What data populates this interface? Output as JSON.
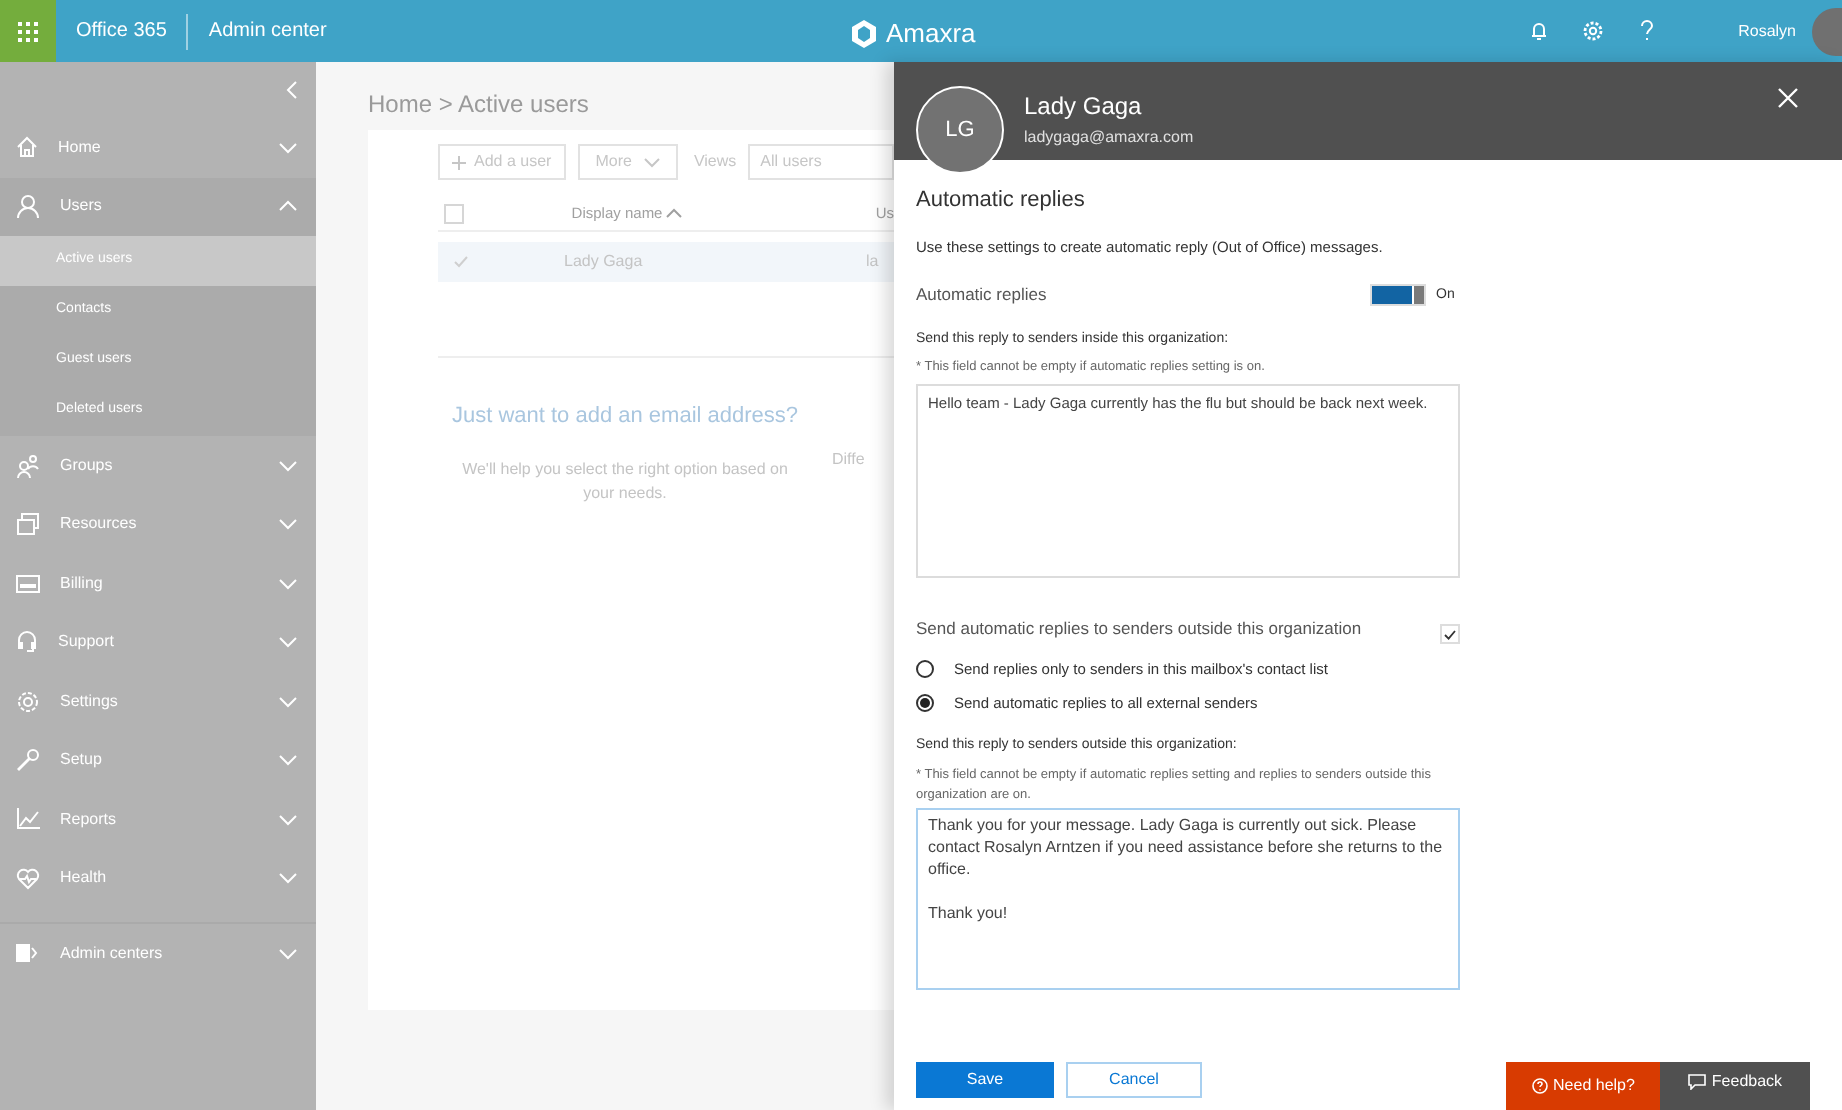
{
  "top_bar": {
    "product": "Office 365",
    "section": "Admin center",
    "brand": "Amaxra",
    "user": "Rosalyn"
  },
  "sidebar": {
    "items": [
      {
        "label": "Home",
        "expanded": false,
        "selected": false
      },
      {
        "label": "Users",
        "expanded": true,
        "selected": false,
        "children": [
          {
            "label": "Active users",
            "selected": true
          },
          {
            "label": "Contacts",
            "selected": false
          },
          {
            "label": "Guest users",
            "selected": false
          },
          {
            "label": "Deleted users",
            "selected": false
          }
        ]
      },
      {
        "label": "Groups",
        "expanded": false,
        "selected": false
      },
      {
        "label": "Resources",
        "expanded": false,
        "selected": false
      },
      {
        "label": "Billing",
        "expanded": false,
        "selected": false
      },
      {
        "label": "Support",
        "expanded": false,
        "selected": false
      },
      {
        "label": "Settings",
        "expanded": false,
        "selected": false
      },
      {
        "label": "Setup",
        "expanded": false,
        "selected": false
      },
      {
        "label": "Reports",
        "expanded": false,
        "selected": false
      },
      {
        "label": "Health",
        "expanded": false,
        "selected": false
      },
      {
        "label": "Admin centers",
        "expanded": false,
        "selected": false
      }
    ]
  },
  "main": {
    "breadcrumb": "Home > Active users",
    "add_user": "Add a user",
    "more": "More",
    "views_label": "Views",
    "views_value": "All users",
    "table": {
      "select_all_checked": false,
      "columns": [
        "Display name",
        "Us"
      ],
      "rows": [
        {
          "display_name": "Lady Gaga",
          "column_2": "la",
          "selected": true
        }
      ]
    },
    "promo_title": "Just want to add an email address?",
    "promo_text": "We'll help you select the right option based on your needs.",
    "promo_text_2": "Diffe"
  },
  "panel": {
    "initials": "LG",
    "name": "Lady Gaga",
    "email": "ladygaga@amaxra.com",
    "title": "Automatic replies",
    "description": "Use these settings to create automatic reply (Out of Office) messages.",
    "toggle": {
      "label": "Automatic replies",
      "on": true,
      "state_text": "On"
    },
    "inside": {
      "label": "Send this reply to senders inside this organization:",
      "note": "* This field cannot be empty if automatic replies setting is on.",
      "value": "Hello team - Lady Gaga currently has the flu but should be back next week."
    },
    "outside": {
      "label": "Send automatic replies to senders outside this organization",
      "checked": true
    },
    "radios": [
      {
        "label": "Send replies only to senders in this mailbox's contact list",
        "selected": false
      },
      {
        "label": "Send automatic replies to all external senders",
        "selected": true
      }
    ],
    "outside_message": {
      "label": "Send this reply to senders outside this organization:",
      "note": "* This field cannot be empty if automatic replies setting and replies to senders outside this organization are on.",
      "value": "Thank you for your message. Lady Gaga is currently out sick. Please contact Rosalyn Arntzen if you need assistance before she returns to the office.\n\nThank you!"
    },
    "buttons": [
      "Save",
      "Cancel"
    ]
  },
  "help": {
    "need_help": "Need help?",
    "feedback": "Feedback"
  }
}
